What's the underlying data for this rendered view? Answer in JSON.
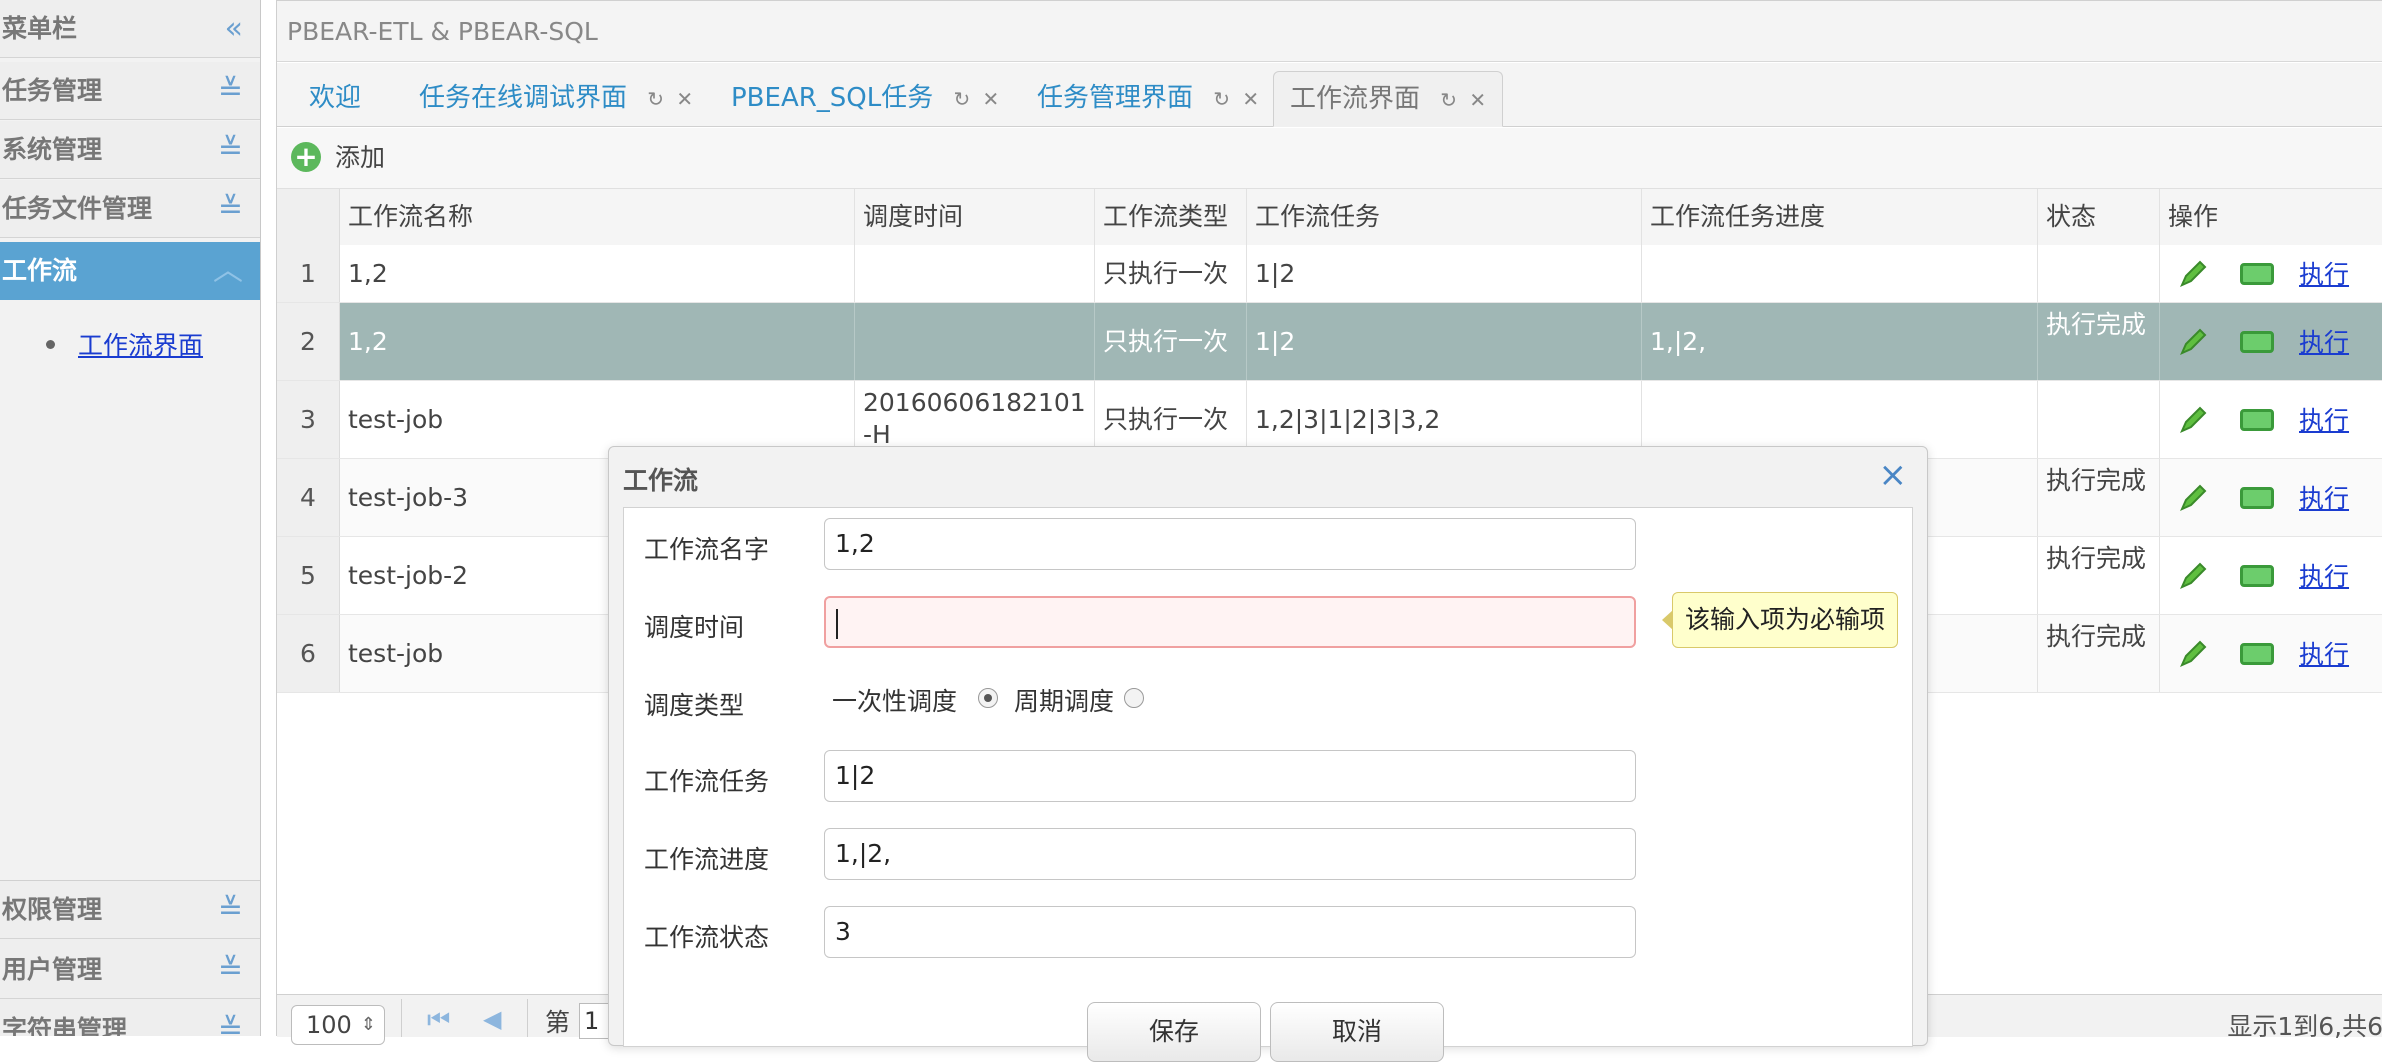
{
  "sidebar": {
    "title": "菜单栏",
    "groups": [
      {
        "label": "任务管理"
      },
      {
        "label": "系统管理"
      },
      {
        "label": "任务文件管理"
      },
      {
        "label": "工作流"
      }
    ],
    "active_item": "工作流界面",
    "bottom_groups": [
      {
        "label": "权限管理"
      },
      {
        "label": "用户管理"
      },
      {
        "label": "字符串管理"
      }
    ]
  },
  "header": {
    "title": "PBEAR-ETL & PBEAR-SQL"
  },
  "tabs": [
    {
      "label": "欢迎"
    },
    {
      "label": "任务在线调试界面"
    },
    {
      "label": "PBEAR_SQL任务"
    },
    {
      "label": "任务管理界面"
    },
    {
      "label": "工作流界面"
    }
  ],
  "toolbar": {
    "add_label": "添加"
  },
  "grid": {
    "columns": [
      "工作流名称",
      "调度时间",
      "工作流类型",
      "工作流任务",
      "工作流任务进度",
      "状态",
      "操作"
    ],
    "rows": [
      {
        "num": "1",
        "name": "1,2",
        "time": "",
        "type": "只执行一次",
        "tasks": "1|2",
        "progress": "",
        "status": "",
        "run": "执行"
      },
      {
        "num": "2",
        "name": "1,2",
        "time": "",
        "type": "只执行一次",
        "tasks": "1|2",
        "progress": "1,|2,",
        "status": "执行完成",
        "run": "执行"
      },
      {
        "num": "3",
        "name": "test-job",
        "time": "20160606182101-H",
        "type": "只执行一次",
        "tasks": "1,2|3|1|2|3|3,2",
        "progress": "",
        "status": "",
        "run": "执行"
      },
      {
        "num": "4",
        "name": "test-job-3",
        "time": "",
        "type": "",
        "tasks": "",
        "progress": "",
        "status": "执行完成",
        "run": "执行"
      },
      {
        "num": "5",
        "name": "test-job-2",
        "time": "",
        "type": "",
        "tasks": "",
        "progress": "",
        "status": "执行完成",
        "run": "执行"
      },
      {
        "num": "6",
        "name": "test-job",
        "time": "",
        "type": "",
        "tasks": "",
        "progress": "",
        "status": "执行完成",
        "run": "执行"
      }
    ]
  },
  "pager": {
    "page_size": "100",
    "page_label": "第",
    "page_value": "1",
    "info": "显示1到6,共6"
  },
  "dialog": {
    "title": "工作流",
    "close": "×",
    "fields": {
      "name_label": "工作流名字",
      "name_value": "1,2",
      "time_label": "调度时间",
      "time_value": "",
      "type_label": "调度类型",
      "radio_once": "一次性调度",
      "radio_periodic": "周期调度",
      "tasks_label": "工作流任务",
      "tasks_value": "1|2",
      "progress_label": "工作流进度",
      "progress_value": "1,|2,",
      "status_label": "工作流状态",
      "status_value": "3"
    },
    "tooltip": "该输入项为必输项",
    "save": "保存",
    "cancel": "取消"
  },
  "colors": {
    "accent": "#5aa3d2",
    "selected_row": "#a0b7b5",
    "link": "#1a3cd0",
    "ok_green": "#5cb85c"
  }
}
